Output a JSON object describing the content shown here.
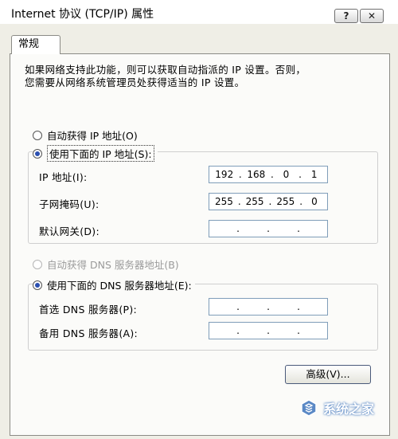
{
  "window": {
    "title": "Internet 协议 (TCP/IP) 属性",
    "help_label": "?",
    "close_label": "✕"
  },
  "tabs": [
    {
      "label": "常规"
    }
  ],
  "description": {
    "line1": "如果网络支持此功能，则可以获取自动指派的 IP 设置。否则，",
    "line2": "您需要从网络系统管理员处获得适当的 IP 设置。"
  },
  "ip_section": {
    "auto_label": "自动获得 IP 地址(O)",
    "manual_label": "使用下面的 IP 地址(S):",
    "selected": "manual",
    "fields": [
      {
        "label": "IP 地址(I):",
        "octets": [
          "192",
          "168",
          "0",
          "1"
        ]
      },
      {
        "label": "子网掩码(U):",
        "octets": [
          "255",
          "255",
          "255",
          "0"
        ]
      },
      {
        "label": "默认网关(D):",
        "octets": [
          "",
          "",
          "",
          ""
        ]
      }
    ]
  },
  "dns_section": {
    "auto_label": "自动获得 DNS 服务器地址(B)",
    "manual_label": "使用下面的 DNS 服务器地址(E):",
    "selected": "manual",
    "fields": [
      {
        "label": "首选 DNS 服务器(P):",
        "octets": [
          "",
          "",
          "",
          ""
        ]
      },
      {
        "label": "备用 DNS 服务器(A):",
        "octets": [
          "",
          "",
          "",
          ""
        ]
      }
    ]
  },
  "buttons": {
    "advanced_label": "高级(V)..."
  },
  "watermark": {
    "text": "系统之家"
  },
  "colors": {
    "selected_radio": "#2a4fb0",
    "input_border": "#7f9db9",
    "dialog_bg": "#efeee6"
  }
}
